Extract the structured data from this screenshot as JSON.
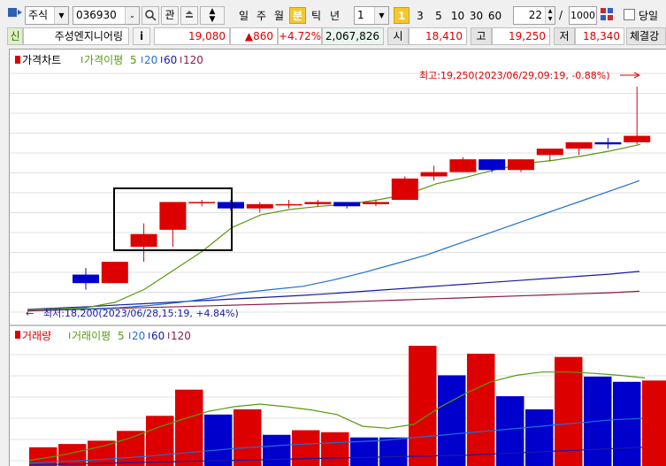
{
  "toolbar": {
    "market": "주식",
    "code": "036930",
    "watch_label": "관",
    "periods": [
      {
        "label": "일",
        "active": false
      },
      {
        "label": "주",
        "active": false
      },
      {
        "label": "월",
        "active": false
      },
      {
        "label": "분",
        "active": true
      },
      {
        "label": "틱",
        "active": false
      },
      {
        "label": "년",
        "active": false
      }
    ],
    "interval_value": "1",
    "quick_intervals": [
      {
        "label": "1",
        "active": true
      },
      {
        "label": "3",
        "active": false
      },
      {
        "label": "5",
        "active": false
      },
      {
        "label": "10",
        "active": false
      },
      {
        "label": "30",
        "active": false
      },
      {
        "label": "60",
        "active": false
      }
    ],
    "display_count": "22",
    "separator": "/",
    "total_count": "1000",
    "today_label": "당일"
  },
  "quote": {
    "credit_badge": "신",
    "name": "주성엔지니어링",
    "info_label": "i",
    "price": "19,080",
    "change": "▲860",
    "change_pct": "+4.72%",
    "volume": "2,067,826",
    "open_label": "시",
    "open": "18,410",
    "high_label": "고",
    "high": "19,250",
    "low_label": "저",
    "low": "18,340",
    "more_label": "체결강"
  },
  "colors": {
    "up": "#dd0000",
    "down": "#0000cc",
    "ma5": "#5a9a10",
    "ma20": "#2070d0",
    "ma60": "#1a1aa0",
    "ma120": "#8b1a4a",
    "box": "#000000"
  },
  "price_panel": {
    "title": "가격차트",
    "ma_label": "가격이평",
    "ma_periods": [
      "5",
      "20",
      "60",
      "120"
    ],
    "max_annotation": "최고:19,250(2023/06/29,09:19, -0.88%)",
    "min_annotation": "최저:18,200(2023/06/28,15:19, +4.84%)"
  },
  "volume_panel": {
    "title": "거래량",
    "ma_label": "거래이평",
    "ma_periods": [
      "5",
      "20",
      "60",
      "120"
    ]
  },
  "chart_data": {
    "type": "candlestick",
    "candles": [
      {
        "o": 18370,
        "h": 18400,
        "l": 18300,
        "c": 18330
      },
      {
        "o": 18330,
        "h": 18430,
        "l": 18330,
        "c": 18430
      },
      {
        "o": 18500,
        "h": 18610,
        "l": 18430,
        "c": 18560
      },
      {
        "o": 18580,
        "h": 18710,
        "l": 18500,
        "c": 18710
      },
      {
        "o": 18710,
        "h": 18720,
        "l": 18690,
        "c": 18710
      },
      {
        "o": 18710,
        "h": 18720,
        "l": 18670,
        "c": 18680
      },
      {
        "o": 18680,
        "h": 18710,
        "l": 18660,
        "c": 18700
      },
      {
        "o": 18700,
        "h": 18720,
        "l": 18680,
        "c": 18700
      },
      {
        "o": 18700,
        "h": 18720,
        "l": 18690,
        "c": 18710
      },
      {
        "o": 18710,
        "h": 18710,
        "l": 18680,
        "c": 18690
      },
      {
        "o": 18700,
        "h": 18720,
        "l": 18690,
        "c": 18710
      },
      {
        "o": 18720,
        "h": 18830,
        "l": 18720,
        "c": 18820
      },
      {
        "o": 18830,
        "h": 18880,
        "l": 18810,
        "c": 18850
      },
      {
        "o": 18850,
        "h": 18920,
        "l": 18850,
        "c": 18910
      },
      {
        "o": 18910,
        "h": 18910,
        "l": 18850,
        "c": 18860
      },
      {
        "o": 18860,
        "h": 18910,
        "l": 18850,
        "c": 18910
      },
      {
        "o": 18930,
        "h": 18960,
        "l": 18900,
        "c": 18960
      },
      {
        "o": 18960,
        "h": 18990,
        "l": 18930,
        "c": 18990
      },
      {
        "o": 18990,
        "h": 19010,
        "l": 18960,
        "c": 18980
      },
      {
        "o": 18990,
        "h": 19250,
        "l": 18980,
        "c": 19020
      }
    ],
    "ma5": [
      18205,
      18210,
      18215,
      18240,
      18300,
      18390,
      18480,
      18590,
      18650,
      18675,
      18690,
      18700,
      18720,
      18745,
      18795,
      18825,
      18860,
      18890,
      18905,
      18925,
      18950,
      18980
    ],
    "ma20": [
      18205,
      18207,
      18210,
      18215,
      18225,
      18240,
      18260,
      18285,
      18300,
      18315,
      18345,
      18380,
      18420,
      18460,
      18510,
      18560,
      18610,
      18660,
      18710,
      18760,
      18810
    ],
    "ma60": [
      18207,
      18213,
      18220,
      18228,
      18235,
      18243,
      18250,
      18258,
      18265,
      18273,
      18282,
      18292,
      18302,
      18312,
      18322,
      18332,
      18342,
      18352,
      18362,
      18372,
      18385
    ],
    "ma120": [
      18200,
      18204,
      18208,
      18212,
      18216,
      18220,
      18224,
      18228,
      18232,
      18236,
      18240,
      18245,
      18250,
      18255,
      18260,
      18265,
      18270,
      18275,
      18280,
      18285,
      18292
    ],
    "volume": [
      {
        "v": 30,
        "up": true
      },
      {
        "v": 35,
        "up": true
      },
      {
        "v": 40,
        "up": true
      },
      {
        "v": 55,
        "up": true
      },
      {
        "v": 78,
        "up": true
      },
      {
        "v": 118,
        "up": true
      },
      {
        "v": 80,
        "up": false
      },
      {
        "v": 88,
        "up": true
      },
      {
        "v": 49,
        "up": false
      },
      {
        "v": 56,
        "up": true
      },
      {
        "v": 53,
        "up": true
      },
      {
        "v": 45,
        "up": false
      },
      {
        "v": 45,
        "up": false
      },
      {
        "v": 185,
        "up": true
      },
      {
        "v": 140,
        "up": false
      },
      {
        "v": 173,
        "up": true
      },
      {
        "v": 108,
        "up": false
      },
      {
        "v": 88,
        "up": false
      },
      {
        "v": 168,
        "up": true
      },
      {
        "v": 138,
        "up": false
      },
      {
        "v": 130,
        "up": false
      },
      {
        "v": 132,
        "up": true
      }
    ],
    "vol_ma5": [
      10,
      16,
      24,
      33,
      45,
      60,
      73,
      85,
      92,
      96,
      92,
      87,
      80,
      62,
      59,
      65,
      91,
      112,
      130,
      140,
      145,
      145,
      143,
      140,
      136
    ],
    "vol_ma20": [
      6,
      8,
      10,
      13,
      16,
      20,
      24,
      28,
      31,
      34,
      36,
      38,
      40,
      44,
      48,
      52,
      56,
      60,
      64,
      68,
      72,
      74
    ],
    "vol_ma60": [
      3,
      4,
      5,
      6,
      7,
      8,
      9,
      10,
      11,
      12,
      13,
      14,
      15,
      16,
      17,
      18,
      20,
      22,
      24,
      26,
      28,
      30
    ]
  }
}
